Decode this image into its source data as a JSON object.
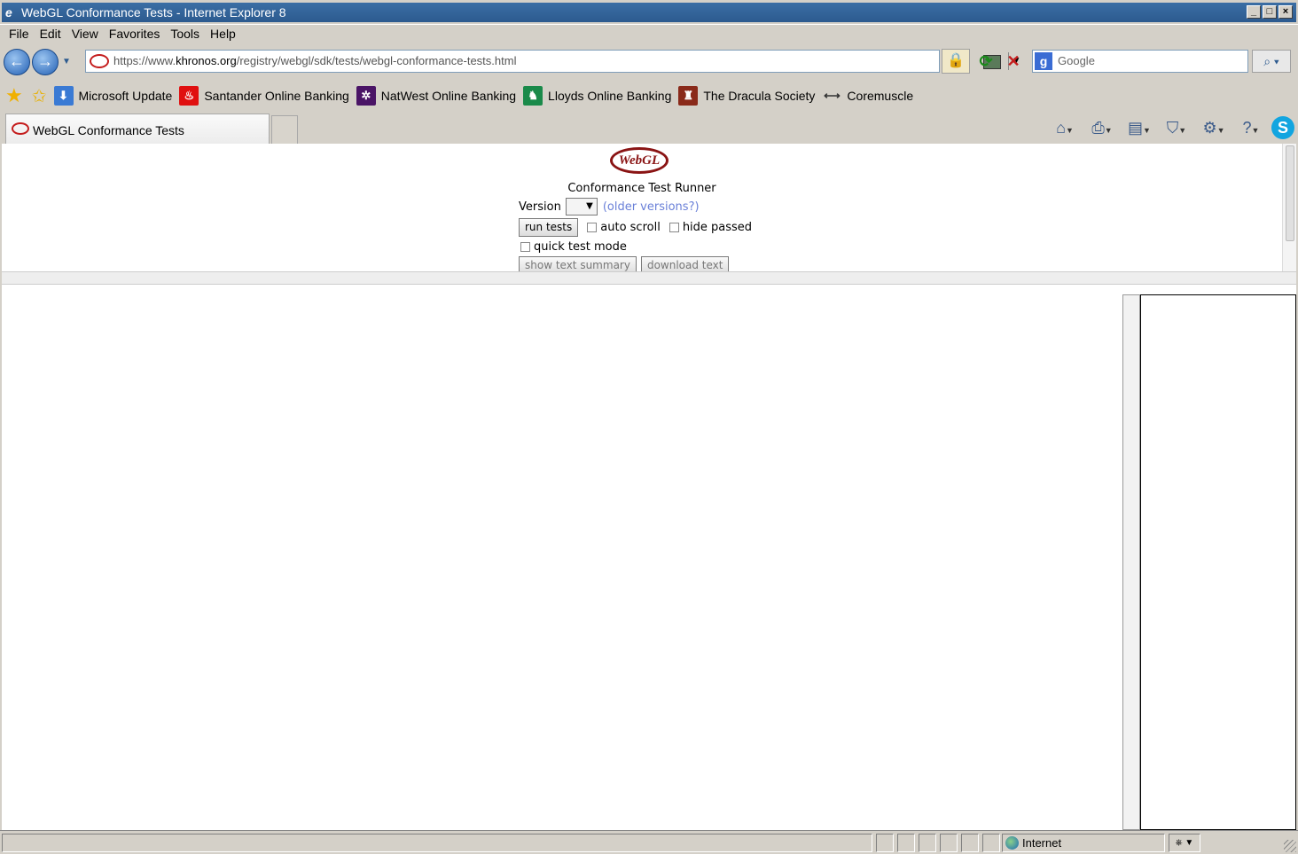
{
  "window": {
    "title": "WebGL Conformance Tests - Internet Explorer 8"
  },
  "menu": [
    "File",
    "Edit",
    "View",
    "Favorites",
    "Tools",
    "Help"
  ],
  "address": {
    "url_prefix": "https://www.",
    "url_domain": "khronos.org",
    "url_path": "/registry/webgl/sdk/tests/webgl-conformance-tests.html"
  },
  "search": {
    "placeholder": "Google"
  },
  "favorites": [
    {
      "label": "Microsoft Update",
      "color": "#3a7ad4"
    },
    {
      "label": "Santander Online Banking",
      "color": "#e01010"
    },
    {
      "label": "NatWest Online Banking",
      "color": "#4a1466"
    },
    {
      "label": "Lloyds Online Banking",
      "color": "#1a8a4a"
    },
    {
      "label": "The Dracula Society",
      "color": "#8a2a1a"
    },
    {
      "label": "Coremuscle",
      "color": "#333333"
    }
  ],
  "tab": {
    "label": "WebGL Conformance Tests"
  },
  "page": {
    "logo_text": "WebGL",
    "title": "Conformance Test Runner",
    "version_label": "Version",
    "version_arrow": "▼",
    "older_link": "(older versions?)",
    "run_button": "run tests",
    "auto_scroll_label": "auto scroll",
    "hide_passed_label": "hide passed",
    "quick_mode_label": "quick test mode",
    "summary_button": "show text summary",
    "download_button": "download text"
  },
  "status": {
    "zone": "Internet"
  },
  "colors": {
    "title_bar": "#2c5a8f",
    "webgl_red": "#8a1414",
    "link": "#6a80d8"
  }
}
